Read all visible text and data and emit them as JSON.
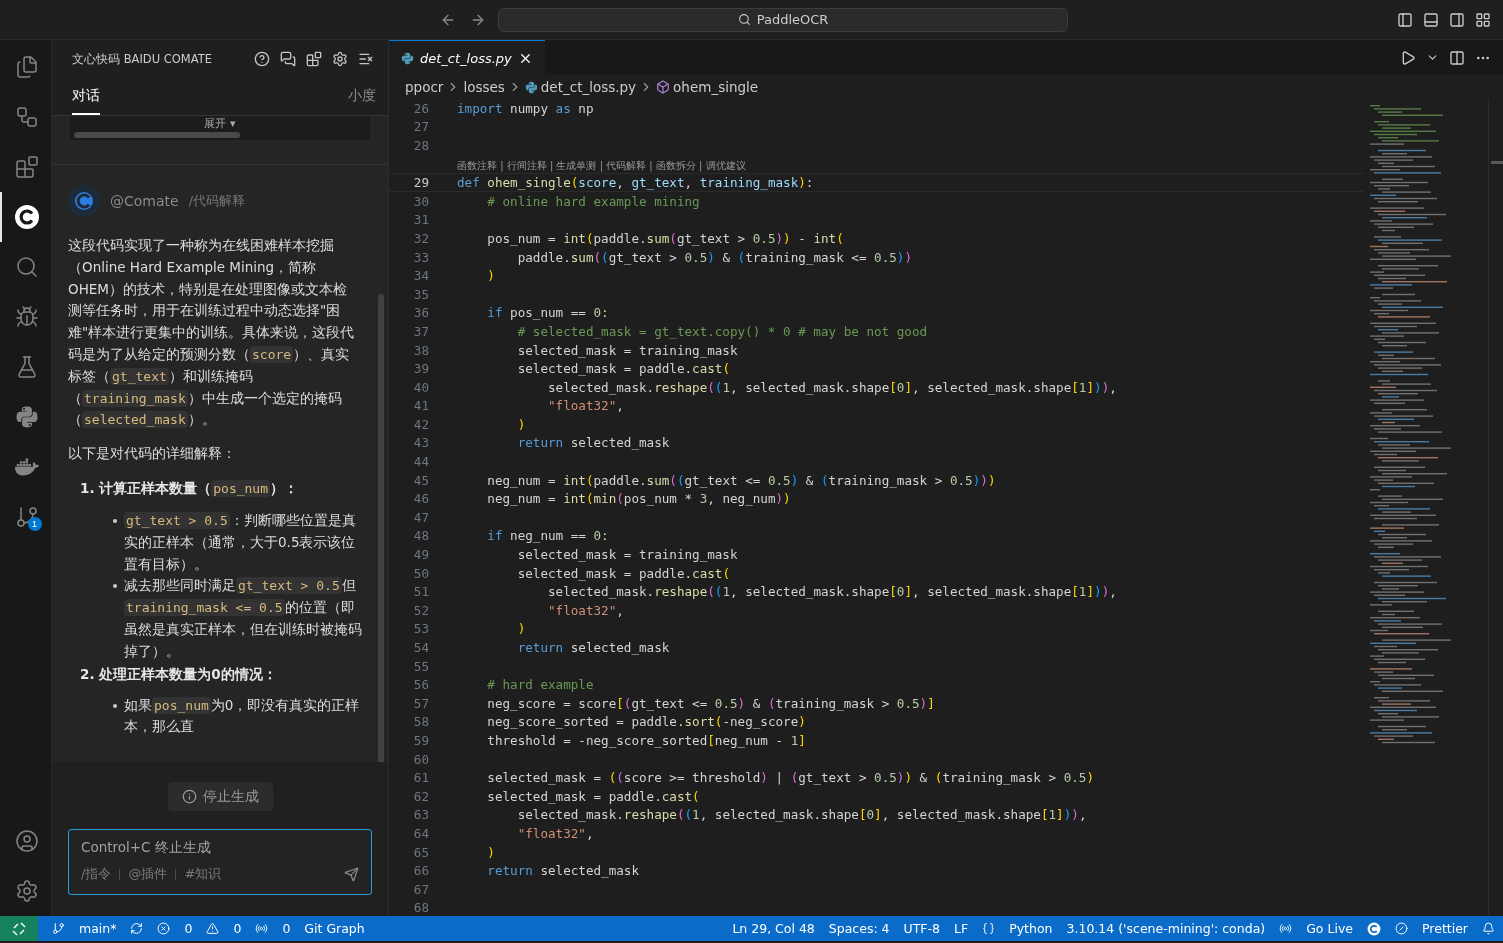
{
  "title_bar": {
    "search": "PaddleOCR"
  },
  "activity_bar": {
    "items": [
      {
        "kind": "files",
        "selected": false
      },
      {
        "kind": "remote",
        "selected": false
      },
      {
        "kind": "extensions",
        "selected": false
      },
      {
        "kind": "comate",
        "selected": true
      },
      {
        "kind": "search",
        "selected": false
      },
      {
        "kind": "debug",
        "selected": false
      },
      {
        "kind": "testing",
        "selected": false
      },
      {
        "kind": "python",
        "selected": false
      },
      {
        "kind": "docker",
        "selected": false
      },
      {
        "kind": "source_control",
        "selected": false,
        "badge": "1"
      }
    ],
    "bottom_items": [
      {
        "kind": "account"
      },
      {
        "kind": "settings"
      }
    ]
  },
  "side_panel": {
    "title": "文心快码 BAIDU COMATE",
    "tabs": [
      {
        "label": "对话",
        "selected": true
      },
      {
        "label": "小度",
        "selected": false
      }
    ],
    "collapsed_card": {
      "toggle": "展开 ▾"
    },
    "message": {
      "author": "@Comate",
      "command": "/代码解释",
      "blocks": [
        {
          "kind": "paragraph",
          "segments": [
            {
              "kind": "text",
              "text": "这段代码实现了一种称为在线困难样本挖掘（Online Hard Example Mining，简称OHEM）的技术，特别是在处理图像或文本检测等任务时，用于在训练过程中动态选择\"困难\"样本进行更集中的训练。具体来说，这段代码是为了从给定的预测分数（"
            },
            {
              "kind": "code",
              "text": "score"
            },
            {
              "kind": "text",
              "text": "）、真实标签（"
            },
            {
              "kind": "code",
              "text": "gt_text"
            },
            {
              "kind": "text",
              "text": "）和训练掩码（"
            },
            {
              "kind": "code",
              "text": "training_mask"
            },
            {
              "kind": "text",
              "text": "）中生成一个选定的掩码（"
            },
            {
              "kind": "code",
              "text": "selected_mask"
            },
            {
              "kind": "text",
              "text": "）。"
            }
          ]
        },
        {
          "kind": "paragraph",
          "segments": [
            {
              "kind": "text",
              "text": "以下是对代码的详细解释："
            }
          ]
        },
        {
          "kind": "heading",
          "number": "1.",
          "segments": [
            {
              "kind": "text",
              "text": "计算正样本数量（"
            },
            {
              "kind": "code",
              "text": "pos_num"
            },
            {
              "kind": "text",
              "text": "）："
            }
          ]
        },
        {
          "kind": "bullet",
          "segments": [
            {
              "kind": "code",
              "text": "gt_text > 0.5"
            },
            {
              "kind": "text",
              "text": "：判断哪些位置是真实的正样本（通常，大于0.5表示该位置有目标）。"
            }
          ]
        },
        {
          "kind": "bullet",
          "segments": [
            {
              "kind": "text",
              "text": "减去那些同时满足"
            },
            {
              "kind": "code",
              "text": "gt_text > 0.5"
            },
            {
              "kind": "text",
              "text": "但"
            },
            {
              "kind": "code",
              "text": "training_mask <= 0.5"
            },
            {
              "kind": "text",
              "text": "的位置（即虽然是真实正样本，但在训练时被掩码掉了）。"
            }
          ]
        },
        {
          "kind": "heading",
          "number": "2.",
          "segments": [
            {
              "kind": "text",
              "text": "处理正样本数量为0的情况："
            }
          ]
        },
        {
          "kind": "bullet",
          "segments": [
            {
              "kind": "text",
              "text": "如果"
            },
            {
              "kind": "code",
              "text": "pos_num"
            },
            {
              "kind": "text",
              "text": "为0，即没有真实的正样本，那么直"
            }
          ]
        }
      ]
    },
    "stop_button": "停止生成",
    "input": {
      "placeholder": "Control+C 终止生成",
      "shortcuts": [
        "/指令",
        "@插件",
        "#知识"
      ]
    }
  },
  "editor": {
    "tabs": [
      {
        "label": "det_ct_loss.py",
        "selected": true
      }
    ],
    "breadcrumbs": [
      {
        "kind": "folder",
        "label": "ppocr"
      },
      {
        "kind": "folder",
        "label": "losses"
      },
      {
        "kind": "python_file",
        "label": "det_ct_loss.py"
      },
      {
        "kind": "symbol",
        "label": "ohem_single"
      }
    ],
    "lines": [
      {
        "kind": "code",
        "n": "26",
        "current": false,
        "t": [
          {
            "kind": "k",
            "text": "import"
          },
          {
            "kind": "p",
            "text": " numpy "
          },
          {
            "kind": "k",
            "text": "as"
          },
          {
            "kind": "p",
            "text": " np"
          }
        ]
      },
      {
        "kind": "code",
        "n": "27",
        "current": false
      },
      {
        "kind": "code",
        "n": "28",
        "current": false
      },
      {
        "kind": "lens",
        "text": "函数注释 | 行间注释 | 生成单测 | 代码解释 | 函数拆分 | 调优建议"
      },
      {
        "kind": "code",
        "n": "29",
        "current": true,
        "t": [
          {
            "kind": "k",
            "text": "def"
          },
          {
            "kind": "f",
            "text": " ohem_single"
          },
          {
            "kind": "b",
            "text": "("
          },
          {
            "kind": "v",
            "text": "score"
          },
          {
            "kind": "p",
            "text": ", "
          },
          {
            "kind": "v",
            "text": "gt_text"
          },
          {
            "kind": "p",
            "text": ", "
          },
          {
            "kind": "v",
            "text": "training_mask"
          },
          {
            "kind": "b",
            "text": ")"
          },
          {
            "kind": "p",
            "text": ":"
          }
        ]
      },
      {
        "kind": "code",
        "n": "30",
        "current": false,
        "t": [
          {
            "kind": "c",
            "text": "    # online hard example mining"
          }
        ]
      },
      {
        "kind": "code",
        "n": "31",
        "current": false
      },
      {
        "kind": "code",
        "n": "32",
        "current": false,
        "t": [
          {
            "kind": "p",
            "text": "    pos_num = "
          },
          {
            "kind": "f",
            "text": "int"
          },
          {
            "kind": "b",
            "text": "("
          },
          {
            "kind": "p",
            "text": "paddle."
          },
          {
            "kind": "f",
            "text": "sum"
          },
          {
            "kind": "b2",
            "text": "("
          },
          {
            "kind": "p",
            "text": "gt_text > "
          },
          {
            "kind": "n",
            "text": "0.5"
          },
          {
            "kind": "b2",
            "text": ")"
          },
          {
            "kind": "b",
            "text": ")"
          },
          {
            "kind": "p",
            "text": " - "
          },
          {
            "kind": "f",
            "text": "int"
          },
          {
            "kind": "b",
            "text": "("
          }
        ]
      },
      {
        "kind": "code",
        "n": "33",
        "current": false,
        "t": [
          {
            "kind": "p",
            "text": "        paddle."
          },
          {
            "kind": "f",
            "text": "sum"
          },
          {
            "kind": "b2",
            "text": "("
          },
          {
            "kind": "b3",
            "text": "("
          },
          {
            "kind": "p",
            "text": "gt_text > "
          },
          {
            "kind": "n",
            "text": "0.5"
          },
          {
            "kind": "b3",
            "text": ")"
          },
          {
            "kind": "p",
            "text": " & "
          },
          {
            "kind": "b3",
            "text": "("
          },
          {
            "kind": "p",
            "text": "training_mask <= "
          },
          {
            "kind": "n",
            "text": "0.5"
          },
          {
            "kind": "b3",
            "text": ")"
          },
          {
            "kind": "b2",
            "text": ")"
          }
        ]
      },
      {
        "kind": "code",
        "n": "34",
        "current": false,
        "t": [
          {
            "kind": "b",
            "text": "    )"
          }
        ]
      },
      {
        "kind": "code",
        "n": "35",
        "current": false
      },
      {
        "kind": "code",
        "n": "36",
        "current": false,
        "t": [
          {
            "kind": "k",
            "text": "    if"
          },
          {
            "kind": "p",
            "text": " pos_num == "
          },
          {
            "kind": "n",
            "text": "0"
          },
          {
            "kind": "p",
            "text": ":"
          }
        ]
      },
      {
        "kind": "code",
        "n": "37",
        "current": false,
        "t": [
          {
            "kind": "c",
            "text": "        # selected_mask = gt_text.copy() * 0 # may be not good"
          }
        ]
      },
      {
        "kind": "code",
        "n": "38",
        "current": false,
        "t": [
          {
            "kind": "p",
            "text": "        selected_mask = training_mask"
          }
        ]
      },
      {
        "kind": "code",
        "n": "39",
        "current": false,
        "t": [
          {
            "kind": "p",
            "text": "        selected_mask = paddle."
          },
          {
            "kind": "f",
            "text": "cast"
          },
          {
            "kind": "b",
            "text": "("
          }
        ]
      },
      {
        "kind": "code",
        "n": "40",
        "current": false,
        "t": [
          {
            "kind": "p",
            "text": "            selected_mask."
          },
          {
            "kind": "f",
            "text": "reshape"
          },
          {
            "kind": "b2",
            "text": "("
          },
          {
            "kind": "b3",
            "text": "("
          },
          {
            "kind": "n",
            "text": "1"
          },
          {
            "kind": "p",
            "text": ", selected_mask.shape"
          },
          {
            "kind": "b",
            "text": "["
          },
          {
            "kind": "n",
            "text": "0"
          },
          {
            "kind": "b",
            "text": "]"
          },
          {
            "kind": "p",
            "text": ", selected_mask.shape"
          },
          {
            "kind": "b",
            "text": "["
          },
          {
            "kind": "n",
            "text": "1"
          },
          {
            "kind": "b",
            "text": "]"
          },
          {
            "kind": "b3",
            "text": ")"
          },
          {
            "kind": "b2",
            "text": ")"
          },
          {
            "kind": "p",
            "text": ","
          }
        ]
      },
      {
        "kind": "code",
        "n": "41",
        "current": false,
        "t": [
          {
            "kind": "s",
            "text": "            \"float32\""
          },
          {
            "kind": "p",
            "text": ","
          }
        ]
      },
      {
        "kind": "code",
        "n": "42",
        "current": false,
        "t": [
          {
            "kind": "b",
            "text": "        )"
          }
        ]
      },
      {
        "kind": "code",
        "n": "43",
        "current": false,
        "t": [
          {
            "kind": "k",
            "text": "        return"
          },
          {
            "kind": "p",
            "text": " selected_mask"
          }
        ]
      },
      {
        "kind": "code",
        "n": "44",
        "current": false
      },
      {
        "kind": "code",
        "n": "45",
        "current": false,
        "t": [
          {
            "kind": "p",
            "text": "    neg_num = "
          },
          {
            "kind": "f",
            "text": "int"
          },
          {
            "kind": "b",
            "text": "("
          },
          {
            "kind": "p",
            "text": "paddle."
          },
          {
            "kind": "f",
            "text": "sum"
          },
          {
            "kind": "b2",
            "text": "("
          },
          {
            "kind": "b3",
            "text": "("
          },
          {
            "kind": "p",
            "text": "gt_text <= "
          },
          {
            "kind": "n",
            "text": "0.5"
          },
          {
            "kind": "b3",
            "text": ")"
          },
          {
            "kind": "p",
            "text": " & "
          },
          {
            "kind": "b3",
            "text": "("
          },
          {
            "kind": "p",
            "text": "training_mask > "
          },
          {
            "kind": "n",
            "text": "0.5"
          },
          {
            "kind": "b3",
            "text": ")"
          },
          {
            "kind": "b2",
            "text": ")"
          },
          {
            "kind": "b",
            "text": ")"
          }
        ]
      },
      {
        "kind": "code",
        "n": "46",
        "current": false,
        "t": [
          {
            "kind": "p",
            "text": "    neg_num = "
          },
          {
            "kind": "f",
            "text": "int"
          },
          {
            "kind": "b",
            "text": "("
          },
          {
            "kind": "f",
            "text": "min"
          },
          {
            "kind": "b2",
            "text": "("
          },
          {
            "kind": "p",
            "text": "pos_num * "
          },
          {
            "kind": "n",
            "text": "3"
          },
          {
            "kind": "p",
            "text": ", neg_num"
          },
          {
            "kind": "b2",
            "text": ")"
          },
          {
            "kind": "b",
            "text": ")"
          }
        ]
      },
      {
        "kind": "code",
        "n": "47",
        "current": false
      },
      {
        "kind": "code",
        "n": "48",
        "current": false,
        "t": [
          {
            "kind": "k",
            "text": "    if"
          },
          {
            "kind": "p",
            "text": " neg_num == "
          },
          {
            "kind": "n",
            "text": "0"
          },
          {
            "kind": "p",
            "text": ":"
          }
        ]
      },
      {
        "kind": "code",
        "n": "49",
        "current": false,
        "t": [
          {
            "kind": "p",
            "text": "        selected_mask = training_mask"
          }
        ]
      },
      {
        "kind": "code",
        "n": "50",
        "current": false,
        "t": [
          {
            "kind": "p",
            "text": "        selected_mask = paddle."
          },
          {
            "kind": "f",
            "text": "cast"
          },
          {
            "kind": "b",
            "text": "("
          }
        ]
      },
      {
        "kind": "code",
        "n": "51",
        "current": false,
        "t": [
          {
            "kind": "p",
            "text": "            selected_mask."
          },
          {
            "kind": "f",
            "text": "reshape"
          },
          {
            "kind": "b2",
            "text": "("
          },
          {
            "kind": "b3",
            "text": "("
          },
          {
            "kind": "n",
            "text": "1"
          },
          {
            "kind": "p",
            "text": ", selected_mask.shape"
          },
          {
            "kind": "b",
            "text": "["
          },
          {
            "kind": "n",
            "text": "0"
          },
          {
            "kind": "b",
            "text": "]"
          },
          {
            "kind": "p",
            "text": ", selected_mask.shape"
          },
          {
            "kind": "b",
            "text": "["
          },
          {
            "kind": "n",
            "text": "1"
          },
          {
            "kind": "b",
            "text": "]"
          },
          {
            "kind": "b3",
            "text": ")"
          },
          {
            "kind": "b2",
            "text": ")"
          },
          {
            "kind": "p",
            "text": ","
          }
        ]
      },
      {
        "kind": "code",
        "n": "52",
        "current": false,
        "t": [
          {
            "kind": "s",
            "text": "            \"float32\""
          },
          {
            "kind": "p",
            "text": ","
          }
        ]
      },
      {
        "kind": "code",
        "n": "53",
        "current": false,
        "t": [
          {
            "kind": "b",
            "text": "        )"
          }
        ]
      },
      {
        "kind": "code",
        "n": "54",
        "current": false,
        "t": [
          {
            "kind": "k",
            "text": "        return"
          },
          {
            "kind": "p",
            "text": " selected_mask"
          }
        ]
      },
      {
        "kind": "code",
        "n": "55",
        "current": false
      },
      {
        "kind": "code",
        "n": "56",
        "current": false,
        "t": [
          {
            "kind": "c",
            "text": "    # hard example"
          }
        ]
      },
      {
        "kind": "code",
        "n": "57",
        "current": false,
        "t": [
          {
            "kind": "p",
            "text": "    neg_score = score"
          },
          {
            "kind": "b",
            "text": "["
          },
          {
            "kind": "b2",
            "text": "("
          },
          {
            "kind": "p",
            "text": "gt_text <= "
          },
          {
            "kind": "n",
            "text": "0.5"
          },
          {
            "kind": "b2",
            "text": ")"
          },
          {
            "kind": "p",
            "text": " & "
          },
          {
            "kind": "b2",
            "text": "("
          },
          {
            "kind": "p",
            "text": "training_mask > "
          },
          {
            "kind": "n",
            "text": "0.5"
          },
          {
            "kind": "b2",
            "text": ")"
          },
          {
            "kind": "b",
            "text": "]"
          }
        ]
      },
      {
        "kind": "code",
        "n": "58",
        "current": false,
        "t": [
          {
            "kind": "p",
            "text": "    neg_score_sorted = paddle."
          },
          {
            "kind": "f",
            "text": "sort"
          },
          {
            "kind": "b",
            "text": "("
          },
          {
            "kind": "p",
            "text": "-neg_score"
          },
          {
            "kind": "b",
            "text": ")"
          }
        ]
      },
      {
        "kind": "code",
        "n": "59",
        "current": false,
        "t": [
          {
            "kind": "p",
            "text": "    threshold = -neg_score_sorted"
          },
          {
            "kind": "b",
            "text": "["
          },
          {
            "kind": "p",
            "text": "neg_num - "
          },
          {
            "kind": "n",
            "text": "1"
          },
          {
            "kind": "b",
            "text": "]"
          }
        ]
      },
      {
        "kind": "code",
        "n": "60",
        "current": false
      },
      {
        "kind": "code",
        "n": "61",
        "current": false,
        "t": [
          {
            "kind": "p",
            "text": "    selected_mask = "
          },
          {
            "kind": "b",
            "text": "("
          },
          {
            "kind": "b2",
            "text": "("
          },
          {
            "kind": "p",
            "text": "score >= threshold"
          },
          {
            "kind": "b2",
            "text": ")"
          },
          {
            "kind": "p",
            "text": " | "
          },
          {
            "kind": "b2",
            "text": "("
          },
          {
            "kind": "p",
            "text": "gt_text > "
          },
          {
            "kind": "n",
            "text": "0.5"
          },
          {
            "kind": "b2",
            "text": ")"
          },
          {
            "kind": "b",
            "text": ")"
          },
          {
            "kind": "p",
            "text": " & "
          },
          {
            "kind": "b",
            "text": "("
          },
          {
            "kind": "p",
            "text": "training_mask > "
          },
          {
            "kind": "n",
            "text": "0.5"
          },
          {
            "kind": "b",
            "text": ")"
          }
        ]
      },
      {
        "kind": "code",
        "n": "62",
        "current": false,
        "t": [
          {
            "kind": "p",
            "text": "    selected_mask = paddle."
          },
          {
            "kind": "f",
            "text": "cast"
          },
          {
            "kind": "b",
            "text": "("
          }
        ]
      },
      {
        "kind": "code",
        "n": "63",
        "current": false,
        "t": [
          {
            "kind": "p",
            "text": "        selected_mask."
          },
          {
            "kind": "f",
            "text": "reshape"
          },
          {
            "kind": "b2",
            "text": "("
          },
          {
            "kind": "b3",
            "text": "("
          },
          {
            "kind": "n",
            "text": "1"
          },
          {
            "kind": "p",
            "text": ", selected_mask.shape"
          },
          {
            "kind": "b",
            "text": "["
          },
          {
            "kind": "n",
            "text": "0"
          },
          {
            "kind": "b",
            "text": "]"
          },
          {
            "kind": "p",
            "text": ", selected_mask.shape"
          },
          {
            "kind": "b",
            "text": "["
          },
          {
            "kind": "n",
            "text": "1"
          },
          {
            "kind": "b",
            "text": "]"
          },
          {
            "kind": "b3",
            "text": ")"
          },
          {
            "kind": "b2",
            "text": ")"
          },
          {
            "kind": "p",
            "text": ","
          }
        ]
      },
      {
        "kind": "code",
        "n": "64",
        "current": false,
        "t": [
          {
            "kind": "s",
            "text": "        \"float32\""
          },
          {
            "kind": "p",
            "text": ","
          }
        ]
      },
      {
        "kind": "code",
        "n": "65",
        "current": false,
        "t": [
          {
            "kind": "b",
            "text": "    )"
          }
        ]
      },
      {
        "kind": "code",
        "n": "66",
        "current": false,
        "t": [
          {
            "kind": "k",
            "text": "    return"
          },
          {
            "kind": "p",
            "text": " selected_mask"
          }
        ]
      },
      {
        "kind": "code",
        "n": "67",
        "current": false
      },
      {
        "kind": "code",
        "n": "68",
        "current": false
      }
    ]
  },
  "status_bar": {
    "left": [
      {
        "kind": "remote"
      },
      {
        "kind": "branch",
        "text": "main*"
      },
      {
        "kind": "sync"
      },
      {
        "kind": "errors",
        "text": "0"
      },
      {
        "kind": "warnings",
        "text": "0"
      },
      {
        "kind": "ports",
        "text": "0"
      },
      {
        "kind": "plain",
        "text": "Git Graph"
      }
    ],
    "right": [
      {
        "kind": "plain",
        "text": "Ln 29, Col 48"
      },
      {
        "kind": "plain",
        "text": "Spaces: 4"
      },
      {
        "kind": "plain",
        "text": "UTF-8"
      },
      {
        "kind": "plain",
        "text": "LF"
      },
      {
        "kind": "language",
        "text": "Python"
      },
      {
        "kind": "plain",
        "text": "3.10.14 ('scene-mining': conda)"
      },
      {
        "kind": "live",
        "text": "Go Live"
      },
      {
        "kind": "comate"
      },
      {
        "kind": "prettier",
        "text": "Prettier"
      },
      {
        "kind": "bell"
      }
    ]
  }
}
